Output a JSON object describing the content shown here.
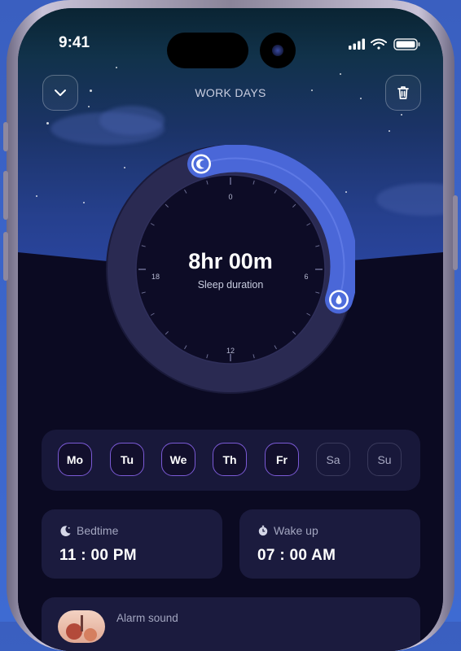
{
  "status_bar": {
    "time": "9:41"
  },
  "header": {
    "title": "WORK DAYS"
  },
  "dial": {
    "duration": "8hr 00m",
    "label": "Sleep duration",
    "ticks": [
      "0",
      "6",
      "12",
      "18"
    ]
  },
  "days": [
    {
      "label": "Mo",
      "selected": true
    },
    {
      "label": "Tu",
      "selected": true
    },
    {
      "label": "We",
      "selected": true
    },
    {
      "label": "Th",
      "selected": true
    },
    {
      "label": "Fr",
      "selected": true
    },
    {
      "label": "Sa",
      "selected": false
    },
    {
      "label": "Su",
      "selected": false
    }
  ],
  "bedtime": {
    "label": "Bedtime",
    "value": "11 : 00 PM"
  },
  "wakeup": {
    "label": "Wake up",
    "value": "07 : 00 AM"
  },
  "alarm": {
    "label": "Alarm sound"
  },
  "colors": {
    "accent": "#7b5ad6",
    "arc": "#4f6ee0",
    "background": "#0b0a22"
  },
  "icons": {
    "collapse": "chevron-down-icon",
    "delete": "trash-icon",
    "bedtime": "moon-icon",
    "wakeup": "alarm-icon"
  }
}
